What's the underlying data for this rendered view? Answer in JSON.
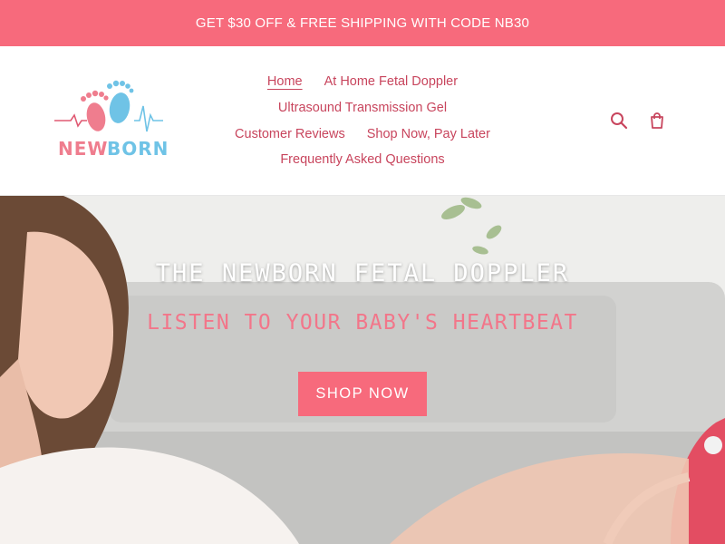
{
  "announcement": {
    "text": "GET $30 OFF & FREE SHIPPING WITH CODE NB30"
  },
  "logo": {
    "text": "NEWBORN",
    "colors": {
      "pink": "#ef7d8e",
      "blue": "#6fc3e6",
      "line": "#e05a73"
    }
  },
  "nav": {
    "items": [
      {
        "label": "Home",
        "active": true
      },
      {
        "label": "At Home Fetal Doppler"
      },
      {
        "label": "Ultrasound Transmission Gel"
      },
      {
        "label": "Customer Reviews"
      },
      {
        "label": "Shop Now, Pay Later"
      },
      {
        "label": "Frequently Asked Questions"
      }
    ]
  },
  "header_icons": {
    "search": "search-icon",
    "cart": "cart-icon"
  },
  "hero": {
    "title": "THE NEWBORN FETAL DOPPLER",
    "subtitle": "LISTEN TO YOUR BABY'S HEARTBEAT",
    "cta_label": "SHOP NOW"
  },
  "colors": {
    "accent": "#f76a7c",
    "nav_text": "#c8455d",
    "subtitle": "#f2768a"
  }
}
